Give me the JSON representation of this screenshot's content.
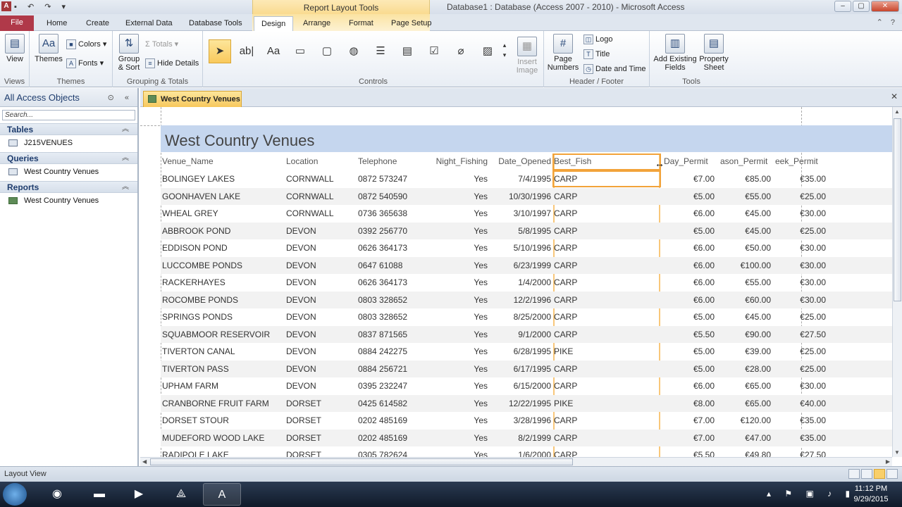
{
  "window": {
    "title": "Database1 : Database (Access 2007 - 2010)  -  Microsoft Access",
    "context_tab_group": "Report Layout Tools"
  },
  "ribbon_tabs": [
    "File",
    "Home",
    "Create",
    "External Data",
    "Database Tools",
    "Design",
    "Arrange",
    "Format",
    "Page Setup"
  ],
  "ribbon": {
    "views": {
      "view_label": "View",
      "group": "Views"
    },
    "themes": {
      "themes_label": "Themes",
      "colors_label": "Colors",
      "fonts_label": "Fonts",
      "group": "Themes"
    },
    "grouping": {
      "group_sort_label": "Group & Sort",
      "totals_label": "Totals",
      "hide_details_label": "Hide Details",
      "group": "Grouping & Totals"
    },
    "controls": {
      "group": "Controls",
      "insert_image_label": "Insert Image"
    },
    "header_footer": {
      "page_numbers_label": "Page Numbers",
      "logo_label": "Logo",
      "title_label": "Title",
      "date_time_label": "Date and Time",
      "group": "Header / Footer"
    },
    "tools": {
      "add_fields_label": "Add Existing Fields",
      "property_sheet_label": "Property Sheet",
      "group": "Tools"
    }
  },
  "nav": {
    "header": "All Access Objects",
    "search_placeholder": "Search...",
    "sections": [
      {
        "title": "Tables",
        "items": [
          "J215VENUES"
        ]
      },
      {
        "title": "Queries",
        "items": [
          "West Country Venues"
        ]
      },
      {
        "title": "Reports",
        "items": [
          "West Country Venues"
        ]
      }
    ]
  },
  "document_tab": "West Country Venues",
  "report": {
    "title": "West Country Venues",
    "columns": [
      "Venue_Name",
      "Location",
      "Telephone",
      "Night_Fishing",
      "Date_Opened",
      "Best_Fish",
      "Day_Permit",
      "ason_Permit",
      "eek_Permit"
    ],
    "rows": [
      [
        "BOLINGEY LAKES",
        "CORNWALL",
        "0872 573247",
        "Yes",
        "7/4/1995",
        "CARP",
        "€7.00",
        "€85.00",
        "€35.00"
      ],
      [
        "GOONHAVEN LAKE",
        "CORNWALL",
        "0872 540590",
        "Yes",
        "10/30/1996",
        "CARP",
        "€5.00",
        "€55.00",
        "€25.00"
      ],
      [
        "WHEAL GREY",
        "CORNWALL",
        "0736 365638",
        "Yes",
        "3/10/1997",
        "CARP",
        "€6.00",
        "€45.00",
        "€30.00"
      ],
      [
        "ABBROOK POND",
        "DEVON",
        "0392 256770",
        "Yes",
        "5/8/1995",
        "CARP",
        "€5.00",
        "€45.00",
        "€25.00"
      ],
      [
        "EDDISON POND",
        "DEVON",
        "0626 364173",
        "Yes",
        "5/10/1996",
        "CARP",
        "€6.00",
        "€50.00",
        "€30.00"
      ],
      [
        "LUCCOMBE PONDS",
        "DEVON",
        "0647 61088",
        "Yes",
        "6/23/1999",
        "CARP",
        "€6.00",
        "€100.00",
        "€30.00"
      ],
      [
        "RACKERHAYES",
        "DEVON",
        "0626 364173",
        "Yes",
        "1/4/2000",
        "CARP",
        "€6.00",
        "€55.00",
        "€30.00"
      ],
      [
        "ROCOMBE PONDS",
        "DEVON",
        "0803 328652",
        "Yes",
        "12/2/1996",
        "CARP",
        "€6.00",
        "€60.00",
        "€30.00"
      ],
      [
        "SPRINGS PONDS",
        "DEVON",
        "0803 328652",
        "Yes",
        "8/25/2000",
        "CARP",
        "€5.00",
        "€45.00",
        "€25.00"
      ],
      [
        "SQUABMOOR RESERVOIR",
        "DEVON",
        "0837 871565",
        "Yes",
        "9/1/2000",
        "CARP",
        "€5.50",
        "€90.00",
        "€27.50"
      ],
      [
        "TIVERTON CANAL",
        "DEVON",
        "0884 242275",
        "Yes",
        "6/28/1995",
        "PIKE",
        "€5.00",
        "€39.00",
        "€25.00"
      ],
      [
        "TIVERTON PASS",
        "DEVON",
        "0884 256721",
        "Yes",
        "6/17/1995",
        "CARP",
        "€5.00",
        "€28.00",
        "€25.00"
      ],
      [
        "UPHAM FARM",
        "DEVON",
        "0395 232247",
        "Yes",
        "6/15/2000",
        "CARP",
        "€6.00",
        "€65.00",
        "€30.00"
      ],
      [
        "CRANBORNE FRUIT FARM",
        "DORSET",
        "0425 614582",
        "Yes",
        "12/22/1995",
        "PIKE",
        "€8.00",
        "€65.00",
        "€40.00"
      ],
      [
        "DORSET STOUR",
        "DORSET",
        "0202 485169",
        "Yes",
        "3/28/1996",
        "CARP",
        "€7.00",
        "€120.00",
        "€35.00"
      ],
      [
        "MUDEFORD WOOD LAKE",
        "DORSET",
        "0202 485169",
        "Yes",
        "8/2/1999",
        "CARP",
        "€7.00",
        "€47.00",
        "€35.00"
      ],
      [
        "RADIPOLE LAKE",
        "DORSET",
        "0305 782624",
        "Yes",
        "1/6/2000",
        "CARP",
        "€5.50",
        "€49.80",
        "€27.50"
      ]
    ]
  },
  "status_bar": {
    "mode": "Layout View"
  },
  "taskbar": {
    "time": "11:12 PM",
    "date": "9/29/2015"
  },
  "colors": {
    "file_tab": "#b03949",
    "title_band": "#c5d6ee",
    "selection": "#f2a33a"
  }
}
